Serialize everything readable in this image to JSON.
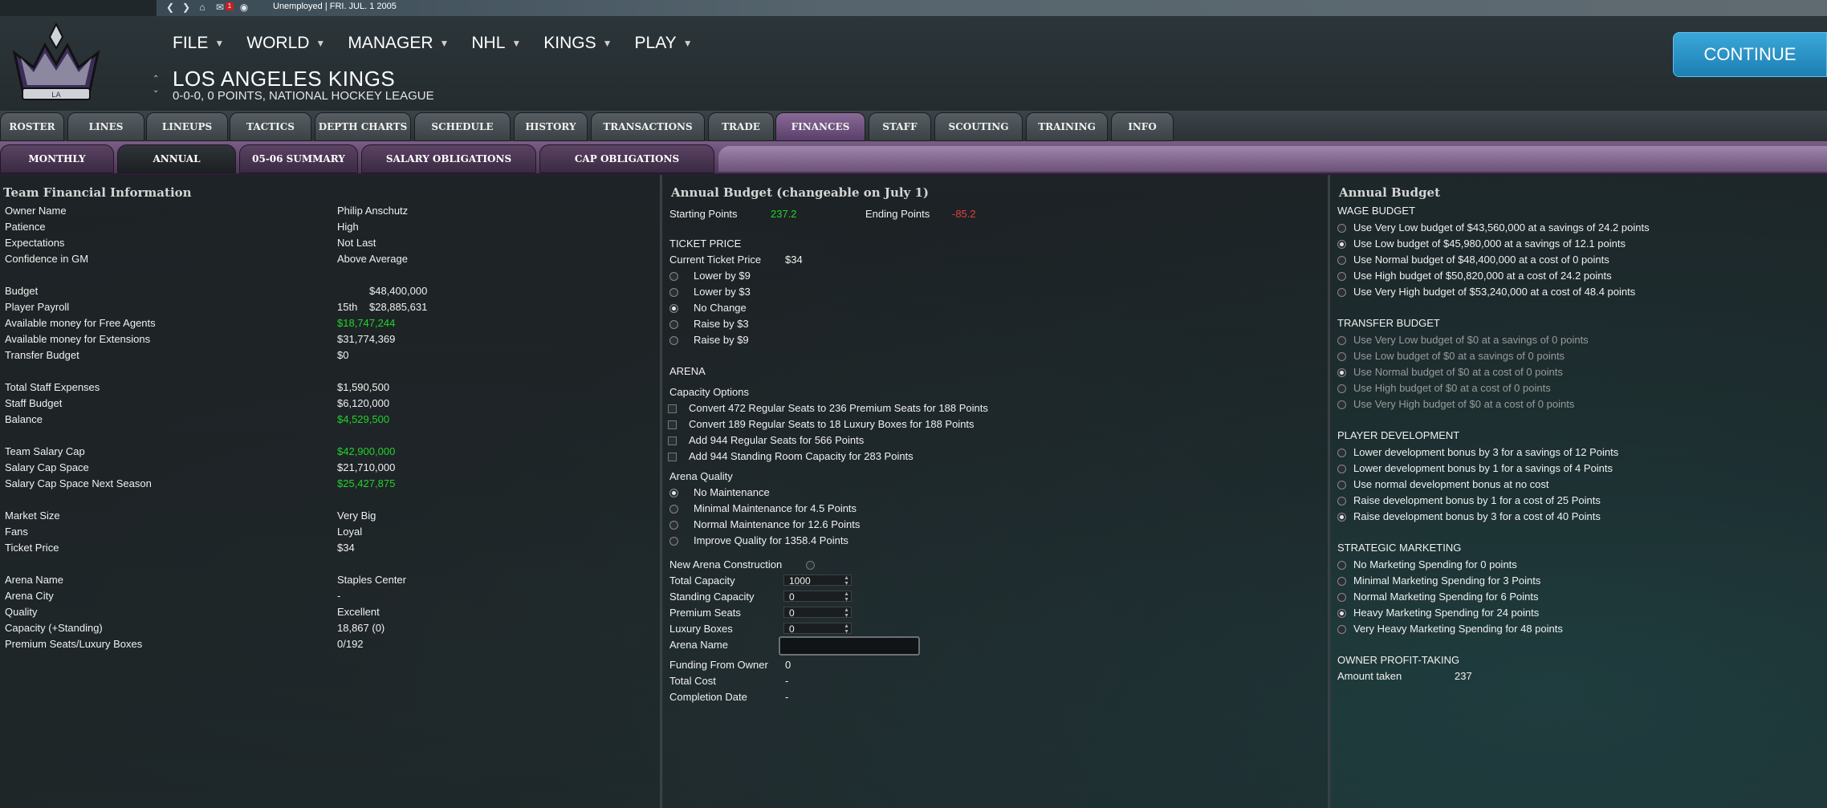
{
  "topbar": {
    "status": "Unemployed |  FRI. JUL. 1 2005",
    "mail_count": "1"
  },
  "menu": [
    "FILE",
    "WORLD",
    "MANAGER",
    "NHL",
    "KINGS",
    "PLAY"
  ],
  "team": {
    "name": "LOS ANGELES KINGS",
    "record": "0-0-0, 0 POINTS, NATIONAL HOCKEY LEAGUE"
  },
  "continue_label": "CONTINUE",
  "tabs": [
    "ROSTER",
    "LINES",
    "LINEUPS",
    "TACTICS",
    "DEPTH CHARTS",
    "SCHEDULE",
    "HISTORY",
    "TRANSACTIONS",
    "TRADE",
    "FINANCES",
    "STAFF",
    "SCOUTING",
    "TRAINING",
    "INFO"
  ],
  "active_tab": "FINANCES",
  "subtabs": [
    "MONTHLY",
    "ANNUAL",
    "05-06 SUMMARY",
    "SALARY OBLIGATIONS",
    "CAP OBLIGATIONS"
  ],
  "active_subtab": "ANNUAL",
  "left": {
    "title": "Team Financial Information",
    "rows": [
      {
        "label": "Owner Name",
        "value": "Philip Anschutz"
      },
      {
        "label": "Patience",
        "value": "High"
      },
      {
        "label": "Expectations",
        "value": "Not Last"
      },
      {
        "label": "Confidence in GM",
        "value": "Above Average"
      },
      {
        "label": "Budget",
        "value": "$48,400,000"
      },
      {
        "label": "Player Payroll",
        "rank": "15th",
        "value": "$28,885,631"
      },
      {
        "label": "Available money for Free Agents",
        "value": "$18,747,244"
      },
      {
        "label": "Available money for Extensions",
        "value": "$31,774,369"
      },
      {
        "label": "Transfer Budget",
        "value": "$0"
      },
      {
        "label": "Total Staff Expenses",
        "value": "$1,590,500"
      },
      {
        "label": "Staff Budget",
        "value": "$6,120,000"
      },
      {
        "label": "Balance",
        "value": "$4,529,500"
      },
      {
        "label": "Team Salary Cap",
        "value": "$42,900,000"
      },
      {
        "label": "Salary Cap Space",
        "value": "$21,710,000"
      },
      {
        "label": "Salary Cap Space Next Season",
        "value": "$25,427,875"
      },
      {
        "label": "Market Size",
        "value": "Very Big"
      },
      {
        "label": "Fans",
        "value": "Loyal"
      },
      {
        "label": "Ticket Price",
        "value": "$34"
      },
      {
        "label": "Arena Name",
        "value": "Staples Center"
      },
      {
        "label": "Arena City",
        "value": "-"
      },
      {
        "label": "Quality",
        "value": "Excellent"
      },
      {
        "label": "Capacity (+Standing)",
        "value": "18,867 (0)"
      },
      {
        "label": "Premium Seats/Luxury Boxes",
        "value": "0/192"
      }
    ]
  },
  "mid": {
    "title": "Annual Budget (changeable on July 1)",
    "starting_points_label": "Starting Points",
    "starting_points": "237.2",
    "ending_points_label": "Ending Points",
    "ending_points": "-85.2",
    "ticket_title": "TICKET PRICE",
    "current_ticket_label": "Current Ticket Price",
    "current_ticket": "$34",
    "ticket_options": [
      "Lower by $9",
      "Lower by $3",
      "No Change",
      "Raise by $3",
      "Raise by $9"
    ],
    "ticket_selected": 2,
    "arena_title": "ARENA",
    "capacity_label": "Capacity  Options",
    "capacity_options": [
      "Convert 472 Regular Seats to 236 Premium Seats for 188 Points",
      "Convert 189 Regular Seats to 18 Luxury Boxes for 188 Points",
      "Add 944 Regular Seats for 566 Points",
      "Add 944 Standing Room Capacity for 283 Points"
    ],
    "quality_label": "Arena Quality",
    "quality_options": [
      "No Maintenance",
      "Minimal Maintenance for 4.5 Points",
      "Normal Maintenance for 12.6 Points",
      "Improve Quality for 1358.4 Points"
    ],
    "quality_selected": 0,
    "new_arena_label": "New Arena Construction",
    "fields": [
      {
        "label": "Total Capacity",
        "value": "1000"
      },
      {
        "label": "Standing Capacity",
        "value": "0"
      },
      {
        "label": "Premium Seats",
        "value": "0"
      },
      {
        "label": "Luxury Boxes",
        "value": "0"
      }
    ],
    "arena_name_label": "Arena Name",
    "funding_label": "Funding From Owner",
    "funding_value": "0",
    "total_cost_label": "Total Cost",
    "total_cost_value": "-",
    "completion_label": "Completion Date",
    "completion_value": "-"
  },
  "right": {
    "title": "Annual Budget",
    "wage_title": "WAGE BUDGET",
    "wage_options": [
      "Use Very Low budget of $43,560,000 at a savings of 24.2 points",
      "Use Low budget of $45,980,000 at a savings of 12.1 points",
      "Use Normal budget of $48,400,000 at a cost of 0 points",
      "Use High budget of $50,820,000 at a cost of 24.2 points",
      "Use Very High budget of $53,240,000 at a cost of 48.4 points"
    ],
    "wage_selected": 1,
    "transfer_title": "TRANSFER BUDGET",
    "transfer_options": [
      "Use Very Low budget of $0 at a savings of 0 points",
      "Use Low budget of $0 at a savings of 0 points",
      "Use Normal budget of $0 at a cost of 0 points",
      "Use High budget of $0 at a cost of 0 points",
      "Use Very High budget of $0 at a cost of 0 points"
    ],
    "transfer_selected": 2,
    "dev_title": "PLAYER DEVELOPMENT",
    "dev_options": [
      "Lower development bonus by 3 for a savings of 12 Points",
      "Lower development bonus by 1 for a savings of 4 Points",
      "Use normal development bonus at no cost",
      "Raise development bonus by 1 for a cost of 25 Points",
      "Raise development bonus by 3 for a cost of 40 Points"
    ],
    "dev_selected": 4,
    "mkt_title": "STRATEGIC MARKETING",
    "mkt_options": [
      "No Marketing Spending for 0 points",
      "Minimal Marketing Spending for 3 Points",
      "Normal Marketing Spending for 6 Points",
      "Heavy Marketing Spending for 24 points",
      "Very Heavy Marketing Spending for 48 points"
    ],
    "mkt_selected": 3,
    "profit_title": "OWNER PROFIT-TAKING",
    "amount_label": "Amount taken",
    "amount_value": "237"
  },
  "colors": {
    "positive": "#22d32a",
    "negative": "#e34141",
    "accent": "#1d7fb3",
    "tab_active": "#5a3f6a"
  },
  "icons": [
    "back-icon",
    "forward-icon",
    "home-icon",
    "mail-icon",
    "globe-icon",
    "chevron-down-icon"
  ]
}
